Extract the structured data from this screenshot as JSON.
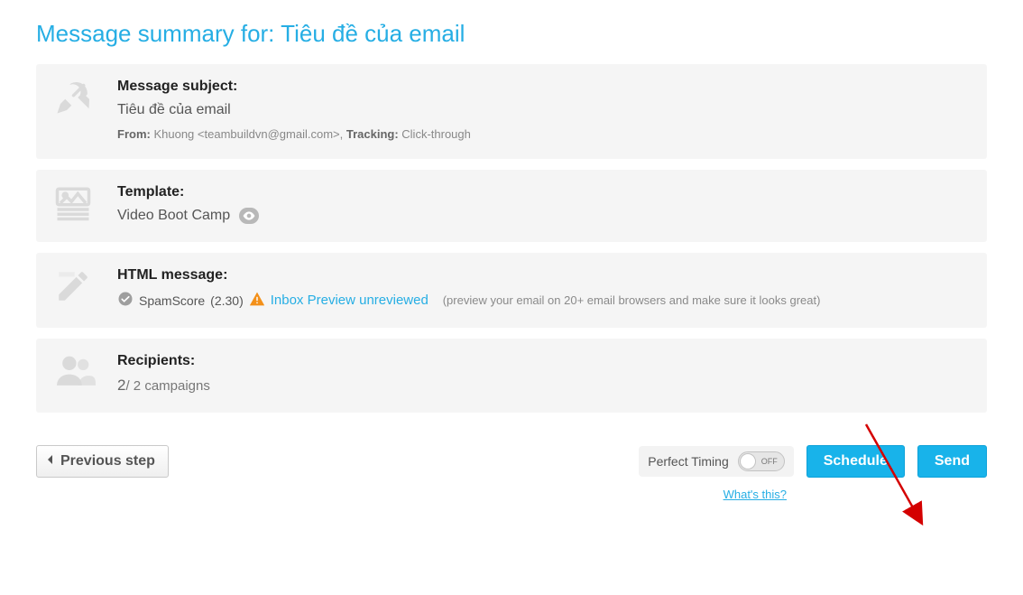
{
  "title": {
    "prefix": "Message summary for: ",
    "subject": "Tiêu đề của email"
  },
  "subject_panel": {
    "label": "Message subject:",
    "value": "Tiêu đề của email",
    "from_label": "From:",
    "from_value": "Khuong <teambuildvn@gmail.com>",
    "tracking_label": "Tracking:",
    "tracking_value": "Click-through"
  },
  "template_panel": {
    "label": "Template:",
    "name": "Video Boot Camp"
  },
  "html_panel": {
    "label": "HTML message:",
    "spam_label": "SpamScore",
    "spam_value": "(2.30)",
    "preview_link": "Inbox Preview unreviewed",
    "preview_hint": "(preview your email on 20+ email browsers and make sure it looks great)"
  },
  "recipients_panel": {
    "label": "Recipients:",
    "count": "2",
    "suffix": "/ 2 campaigns"
  },
  "footer": {
    "prev": "Previous step",
    "perfect_timing": "Perfect Timing",
    "toggle_state": "OFF",
    "schedule": "Schedule",
    "send": "Send",
    "whats_this": "What's this?"
  }
}
